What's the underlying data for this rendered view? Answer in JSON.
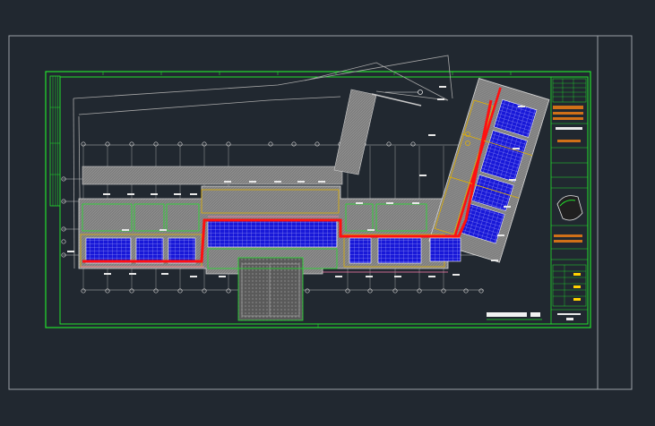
{
  "app": {
    "view": "cad-drawing-viewport",
    "background": "#212830"
  },
  "colors": {
    "paper_border": "#9aa0a6",
    "frame_green": "#22e02c",
    "building_gray": "#8c8c8c",
    "corridor_red": "#ff1010",
    "panel_blue": "#1515e0",
    "outline_yellow": "#e0b000",
    "annotation_white": "#e8e8e8",
    "title_orange": "#d07018"
  },
  "icons": {
    "north_arrow": "north-arrow-icon",
    "axis_bubble": "grid-axis-bubble-icon"
  }
}
